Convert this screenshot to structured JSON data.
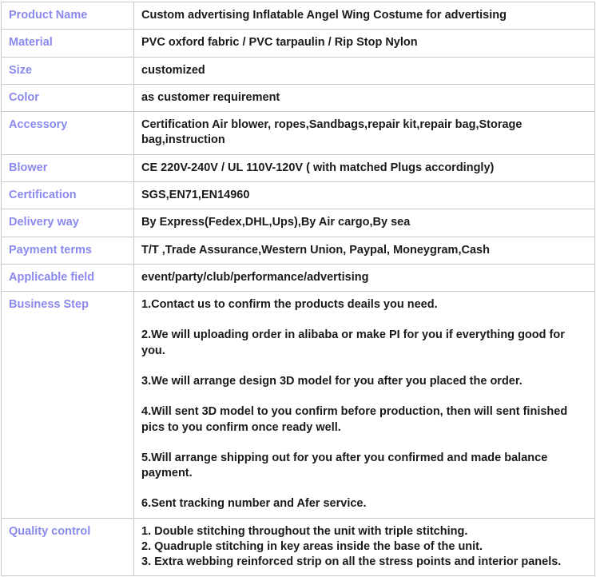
{
  "table": {
    "rows": [
      {
        "label": "Product Name",
        "lines": [
          "Custom advertising Inflatable Angel Wing Costume for advertising"
        ],
        "spacing": "tight"
      },
      {
        "label": "Material",
        "lines": [
          "PVC oxford fabric / PVC tarpaulin / Rip Stop Nylon"
        ],
        "spacing": "tight"
      },
      {
        "label": "Size",
        "lines": [
          "customized"
        ],
        "spacing": "tight"
      },
      {
        "label": "Color",
        "lines": [
          "as customer requirement"
        ],
        "spacing": "tight"
      },
      {
        "label": "Accessory",
        "lines": [
          "Certification Air blower, ropes,Sandbags,repair kit,repair bag,Storage bag,instruction"
        ],
        "spacing": "tight"
      },
      {
        "label": "Blower",
        "lines": [
          "CE 220V-240V / UL 110V-120V ( with matched Plugs accordingly)"
        ],
        "spacing": "tight"
      },
      {
        "label": "Certification",
        "lines": [
          "SGS,EN71,EN14960"
        ],
        "spacing": "tight"
      },
      {
        "label": "Delivery way",
        "lines": [
          "By Express(Fedex,DHL,Ups),By Air cargo,By sea"
        ],
        "spacing": "tight"
      },
      {
        "label": "Payment terms",
        "lines": [
          "T/T ,Trade Assurance,Western Union, Paypal, Moneygram,Cash"
        ],
        "spacing": "tight"
      },
      {
        "label": "Applicable field",
        "lines": [
          "event/party/club/performance/advertising"
        ],
        "spacing": "tight"
      },
      {
        "label": "Business Step",
        "lines": [
          "1.Contact us to confirm the products deails you need.",
          "2.We will uploading order in alibaba or make PI for you if everything good for you.",
          "3.We will arrange design 3D model for you after you placed the order.",
          "4.Will sent 3D model to you confirm before production, then will sent finished pics to you confirm once ready well.",
          "5.Will arrange shipping out for you after you confirmed and made balance payment.",
          "6.Sent tracking number and Afer service."
        ],
        "spacing": "steps"
      },
      {
        "label": "Quality control",
        "lines": [
          "1. Double stitching throughout the unit with triple stitching.",
          "2. Quadruple stitching in key areas inside the base of the unit.",
          "3. Extra webbing reinforced strip on all the stress points and interior panels."
        ],
        "spacing": "tight"
      }
    ]
  },
  "colors": {
    "label_text": "#8a8aee",
    "value_text": "#1a1a1a",
    "border": "#c9c9c9",
    "background": "#ffffff"
  }
}
